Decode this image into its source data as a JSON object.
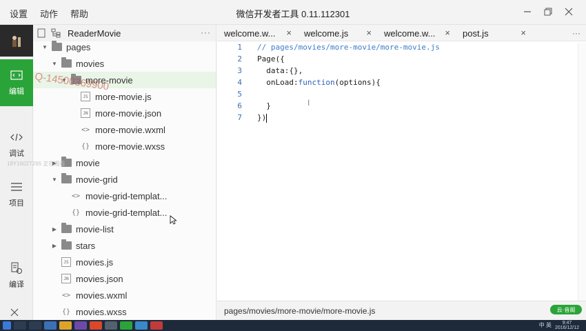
{
  "titlebar": {
    "menu": [
      "设置",
      "动作",
      "帮助"
    ],
    "title": "微信开发者工具 0.11.112301"
  },
  "activity": {
    "items": [
      {
        "label": "编辑",
        "icon": "code-icon",
        "active": true
      },
      {
        "label": "调试",
        "icon": "debug-icon",
        "active": false
      },
      {
        "label": "项目",
        "icon": "menu-icon",
        "active": false
      },
      {
        "label": "编译",
        "icon": "compile-icon",
        "active": false
      }
    ]
  },
  "explorer": {
    "project": "ReaderMovie",
    "more": "···",
    "tree": [
      {
        "label": "pages",
        "type": "folder",
        "expanded": true,
        "depth": 0
      },
      {
        "label": "movies",
        "type": "folder",
        "expanded": true,
        "depth": 1
      },
      {
        "label": "more-movie",
        "type": "folder",
        "expanded": true,
        "depth": 2,
        "selected": true
      },
      {
        "label": "more-movie.js",
        "type": "js",
        "badge": "JS",
        "depth": 3
      },
      {
        "label": "more-movie.json",
        "type": "json",
        "badge": "JN",
        "depth": 3
      },
      {
        "label": "more-movie.wxml",
        "type": "wxml",
        "badge": "<>",
        "depth": 3
      },
      {
        "label": "more-movie.wxss",
        "type": "wxss",
        "badge": "{}",
        "depth": 3
      },
      {
        "label": "movie",
        "type": "folder",
        "expanded": false,
        "depth": 1
      },
      {
        "label": "movie-grid",
        "type": "folder",
        "expanded": true,
        "depth": 1
      },
      {
        "label": "movie-grid-templat...",
        "type": "wxml",
        "badge": "<>",
        "depth": 2
      },
      {
        "label": "movie-grid-templat...",
        "type": "wxss",
        "badge": "{}",
        "depth": 2
      },
      {
        "label": "movie-list",
        "type": "folder",
        "expanded": false,
        "depth": 1
      },
      {
        "label": "stars",
        "type": "folder",
        "expanded": false,
        "depth": 1
      },
      {
        "label": "movies.js",
        "type": "js",
        "badge": "JS",
        "depth": 1
      },
      {
        "label": "movies.json",
        "type": "json",
        "badge": "JN",
        "depth": 1
      },
      {
        "label": "movies.wxml",
        "type": "wxml",
        "badge": "<>",
        "depth": 1
      },
      {
        "label": "movies.wxss",
        "type": "wxss",
        "badge": "{}",
        "depth": 1
      }
    ]
  },
  "watermark": {
    "text": "Q-14500369900",
    "line2": "18Y1602T265 正在观看"
  },
  "editor": {
    "tabs": [
      {
        "label": "welcome.w...",
        "active": true
      },
      {
        "label": "welcome.js",
        "active": false
      },
      {
        "label": "welcome.w...",
        "active": false
      },
      {
        "label": "post.js",
        "active": false
      }
    ],
    "more": "···",
    "lines": [
      "1",
      "2",
      "3",
      "4",
      "5",
      "6",
      "7"
    ],
    "code": {
      "l1": "// pages/movies/more-movie/more-movie.js",
      "l2a": "Page",
      "l2b": "({",
      "l3": "  data:{},",
      "l4a": "  onLoad:",
      "l4b": "function",
      "l4c": "(options){",
      "l6": "  }",
      "l7": "})"
    },
    "ibeam": "I",
    "status_path": "pages/movies/more-movie/more-movie.js",
    "badge": "云·音阁"
  },
  "taskbar": {
    "tray": "中 英",
    "time": "9:47",
    "date": "2016/12/12"
  },
  "colors": {
    "accent": "#2aa439",
    "link_blue": "#3d7cc9"
  }
}
